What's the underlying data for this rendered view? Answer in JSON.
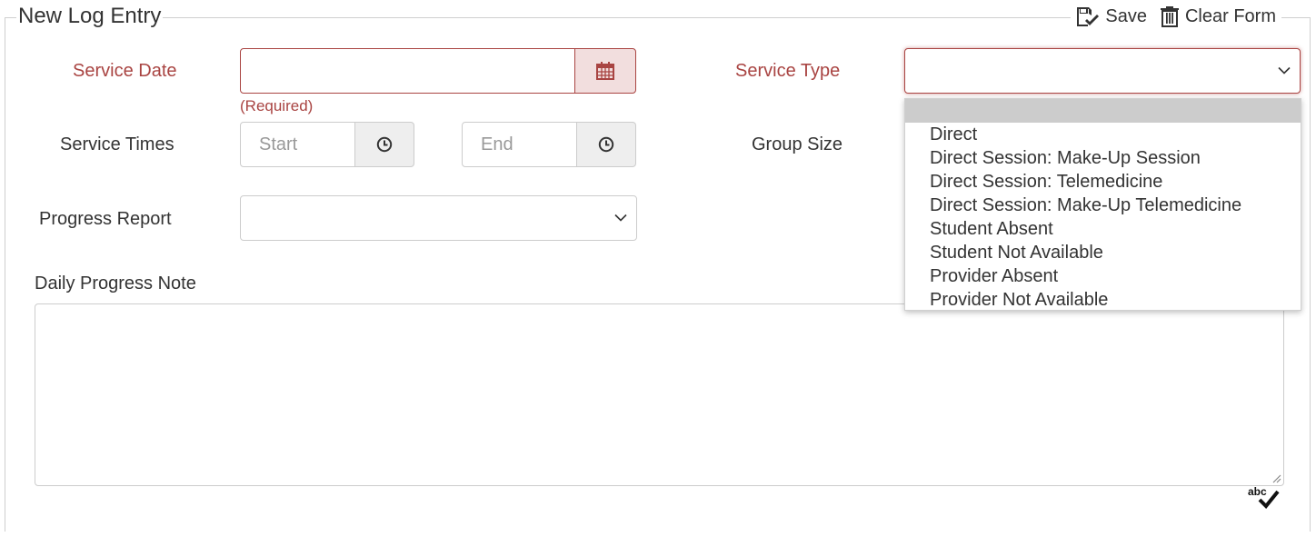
{
  "form": {
    "legend": "New Log Entry",
    "toolbar": {
      "save_label": "Save",
      "clear_label": "Clear Form"
    },
    "service_date": {
      "label": "Service Date",
      "value": "",
      "help": "(Required)"
    },
    "service_type": {
      "label": "Service Type",
      "selected": "",
      "options": [
        "",
        "Direct",
        "Direct Session: Make-Up Session",
        "Direct Session: Telemedicine",
        "Direct Session: Make-Up Telemedicine",
        "Student Absent",
        "Student Not Available",
        "Provider Absent",
        "Provider Not Available"
      ]
    },
    "service_times": {
      "label": "Service Times",
      "start_placeholder": "Start",
      "end_placeholder": "End"
    },
    "group_size": {
      "label": "Group Size"
    },
    "progress_report": {
      "label": "Progress Report",
      "selected": ""
    },
    "daily_note": {
      "label": "Daily Progress Note",
      "value": ""
    }
  },
  "icons": {
    "save": "save-icon",
    "clear": "trash-icon",
    "calendar": "calendar-icon",
    "clock": "clock-icon",
    "chevron": "chevron-down-icon",
    "spellcheck": "spellcheck-icon"
  },
  "colors": {
    "required": "#a94442",
    "addon_error_bg": "#f2dede",
    "addon_bg": "#eeeeee",
    "border": "#cccccc"
  }
}
